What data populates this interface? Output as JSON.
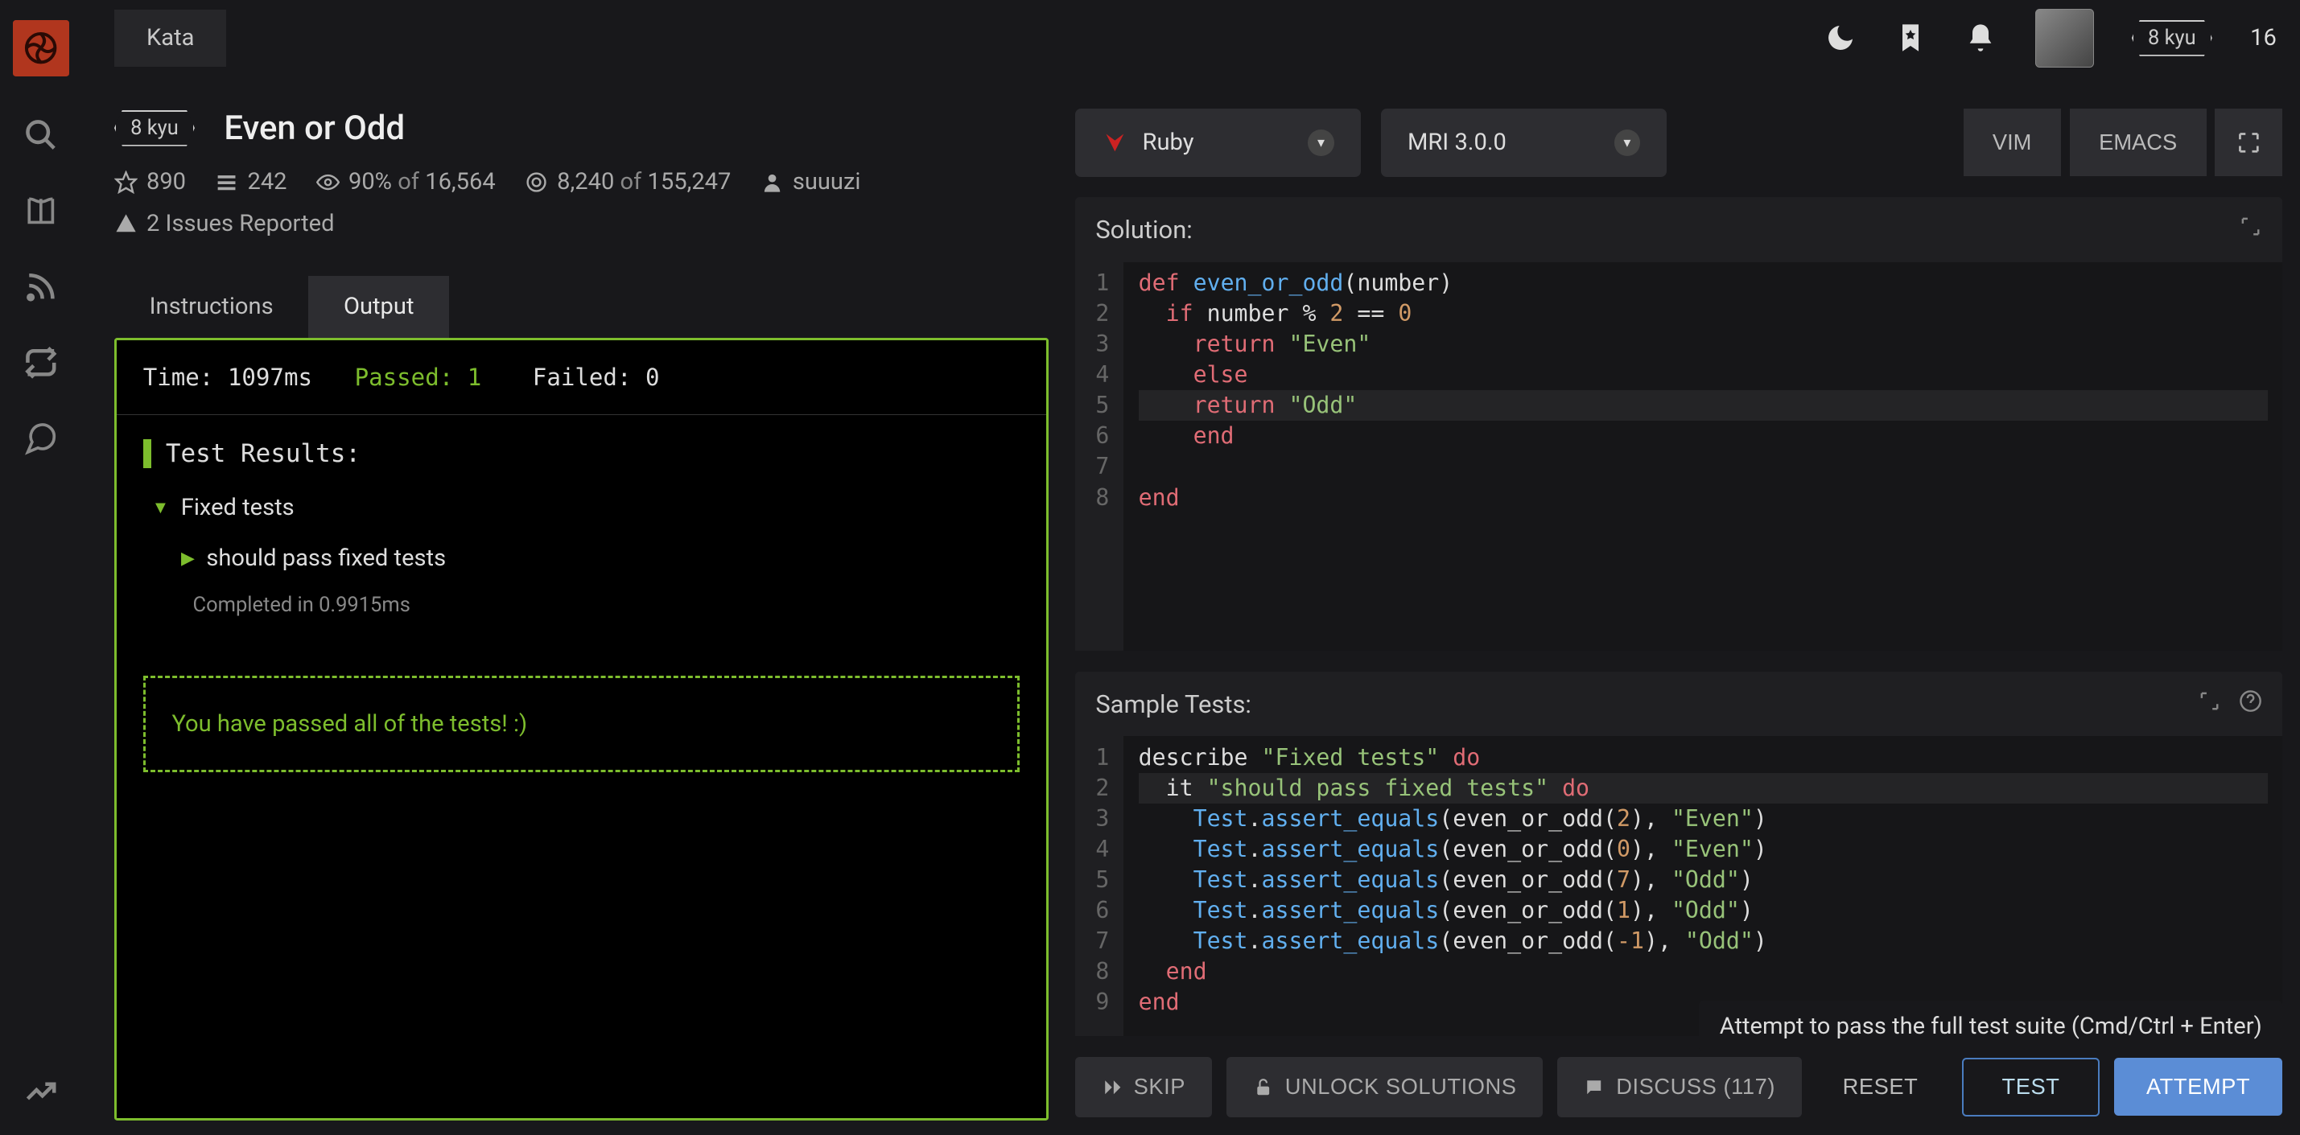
{
  "topbar": {
    "tab": "Kata",
    "user_kyu": "8 kyu",
    "user_rank": "16"
  },
  "kata": {
    "kyu": "8 kyu",
    "title": "Even or Odd",
    "stars": "890",
    "collections": "242",
    "satisfaction_pct": "90%",
    "satisfaction_of": "of",
    "satisfaction_total": "16,564",
    "completed": "8,240",
    "completed_of": "of",
    "completed_total": "155,247",
    "author": "suuuzi",
    "issues": "2 Issues Reported"
  },
  "tabs": {
    "instructions": "Instructions",
    "output": "Output"
  },
  "output": {
    "time_label": "Time: 1097ms",
    "passed_label": "Passed: 1",
    "failed_label": "Failed: 0",
    "results_header": "Test Results:",
    "group": "Fixed tests",
    "case": "should pass fixed tests",
    "completed_in": "Completed in 0.9915ms",
    "all_passed": "You have passed all of the tests! :)"
  },
  "selectors": {
    "language": "Ruby",
    "version": "MRI 3.0.0",
    "vim": "VIM",
    "emacs": "EMACS"
  },
  "solution": {
    "title": "Solution:",
    "lines": [
      {
        "n": "1",
        "html": "<span class='kw'>def</span> <span class='fn'>even_or_odd</span>(number)"
      },
      {
        "n": "2",
        "html": "  <span class='kw'>if</span> number <span class='op'>%</span> <span class='num'>2</span> <span class='op'>==</span> <span class='num'>0</span>"
      },
      {
        "n": "3",
        "html": "    <span class='kw'>return</span> <span class='str'>\"Even\"</span>"
      },
      {
        "n": "4",
        "html": "    <span class='kw'>else</span>"
      },
      {
        "n": "5",
        "html": "    <span class='kw'>return</span> <span class='str'>\"Odd\"</span>",
        "hl": true
      },
      {
        "n": "6",
        "html": "    <span class='kw'>end</span>"
      },
      {
        "n": "7",
        "html": ""
      },
      {
        "n": "8",
        "html": "<span class='kw'>end</span>"
      }
    ]
  },
  "tests": {
    "title": "Sample Tests:",
    "lines": [
      {
        "n": "1",
        "html": "describe <span class='str'>\"Fixed tests\"</span> <span class='kw'>do</span>"
      },
      {
        "n": "2",
        "html": "  it <span class='str'>\"should pass fixed tests\"</span> <span class='kw'>do</span>",
        "hl": true
      },
      {
        "n": "3",
        "html": "    <span class='fn'>Test</span>.<span class='fn'>assert_equals</span>(even_or_odd(<span class='num'>2</span>), <span class='str'>\"Even\"</span>)"
      },
      {
        "n": "4",
        "html": "    <span class='fn'>Test</span>.<span class='fn'>assert_equals</span>(even_or_odd(<span class='num'>0</span>), <span class='str'>\"Even\"</span>)"
      },
      {
        "n": "5",
        "html": "    <span class='fn'>Test</span>.<span class='fn'>assert_equals</span>(even_or_odd(<span class='num'>7</span>), <span class='str'>\"Odd\"</span>)"
      },
      {
        "n": "6",
        "html": "    <span class='fn'>Test</span>.<span class='fn'>assert_equals</span>(even_or_odd(<span class='num'>1</span>), <span class='str'>\"Odd\"</span>)"
      },
      {
        "n": "7",
        "html": "    <span class='fn'>Test</span>.<span class='fn'>assert_equals</span>(even_or_odd(<span class='num'>-1</span>), <span class='str'>\"Odd\"</span>)"
      },
      {
        "n": "8",
        "html": "  <span class='kw'>end</span>"
      },
      {
        "n": "9",
        "html": "<span class='kw'>end</span>"
      }
    ]
  },
  "actions": {
    "skip": "SKIP",
    "unlock": "UNLOCK SOLUTIONS",
    "discuss": "DISCUSS (117)",
    "reset": "RESET",
    "test": "TEST",
    "attempt": "ATTEMPT",
    "tooltip": "Attempt to pass the full test suite (Cmd/Ctrl + Enter)"
  }
}
